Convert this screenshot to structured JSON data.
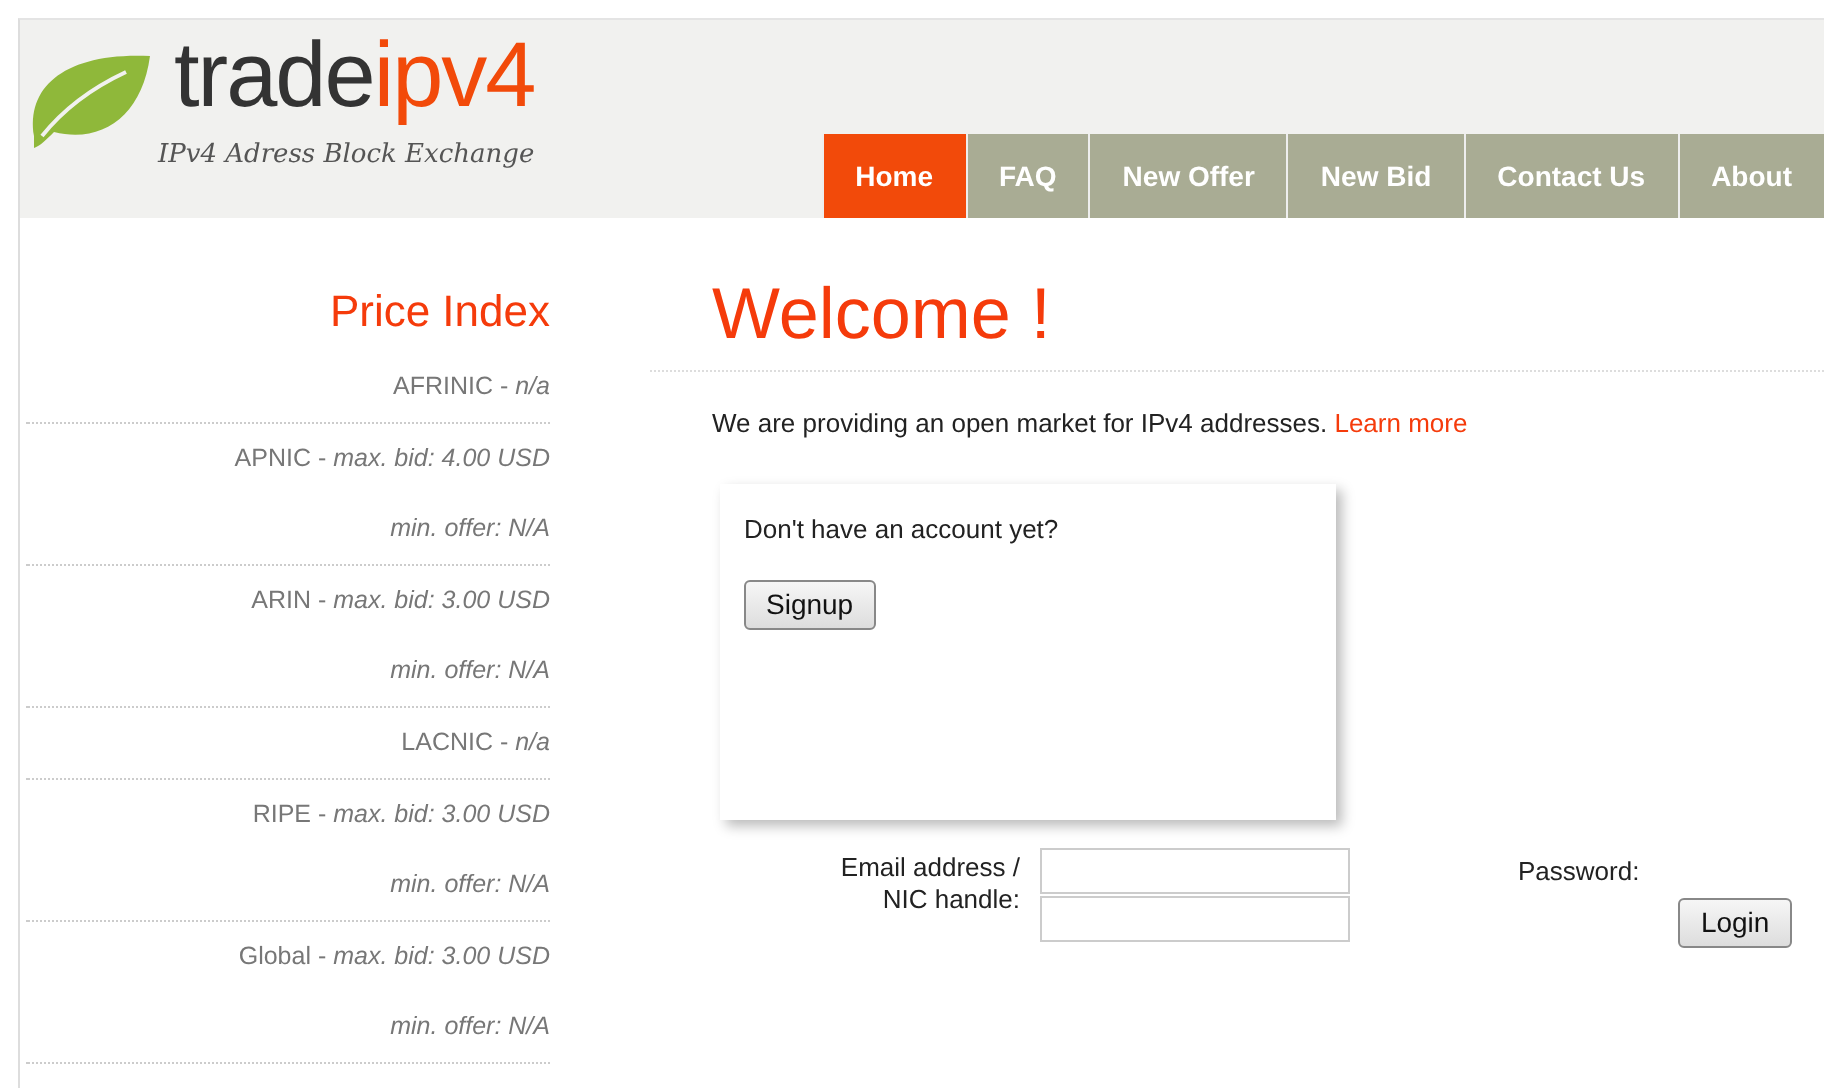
{
  "logo": {
    "name_dark": "trade",
    "name_accent": "ipv4",
    "tagline": "IPv4 Adress Block Exchange"
  },
  "nav": [
    {
      "label": "Home",
      "selected": true
    },
    {
      "label": "FAQ",
      "selected": false
    },
    {
      "label": "New Offer",
      "selected": false
    },
    {
      "label": "New Bid",
      "selected": false
    },
    {
      "label": "Contact Us",
      "selected": false
    },
    {
      "label": "About",
      "selected": false
    }
  ],
  "price_index": {
    "title": "Price Index",
    "entries": [
      {
        "lines": [
          "AFRINIC - *n/a*"
        ]
      },
      {
        "lines": [
          "APNIC - *max. bid: 4.00 USD*",
          "min. offer: N/A"
        ]
      },
      {
        "lines": [
          "ARIN - *max. bid: 3.00 USD*",
          "min. offer: N/A"
        ]
      },
      {
        "lines": [
          "LACNIC - *n/a*"
        ]
      },
      {
        "lines": [
          "RIPE - *max. bid: 3.00 USD*",
          "min. offer: N/A"
        ]
      },
      {
        "lines": [
          "Global - *max. bid: 3.00 USD*",
          "min. offer: N/A"
        ]
      }
    ]
  },
  "main": {
    "title": "Welcome !",
    "intro": "We are providing an open market for IPv4 addresses.",
    "intro_link": "Learn more",
    "signup_box": {
      "question": "Don't have an account yet?",
      "button": "Signup"
    },
    "login": {
      "email_label_lines": [
        "Email address /",
        "NIC handle:"
      ],
      "password_label": "Password:",
      "button": "Login"
    }
  }
}
